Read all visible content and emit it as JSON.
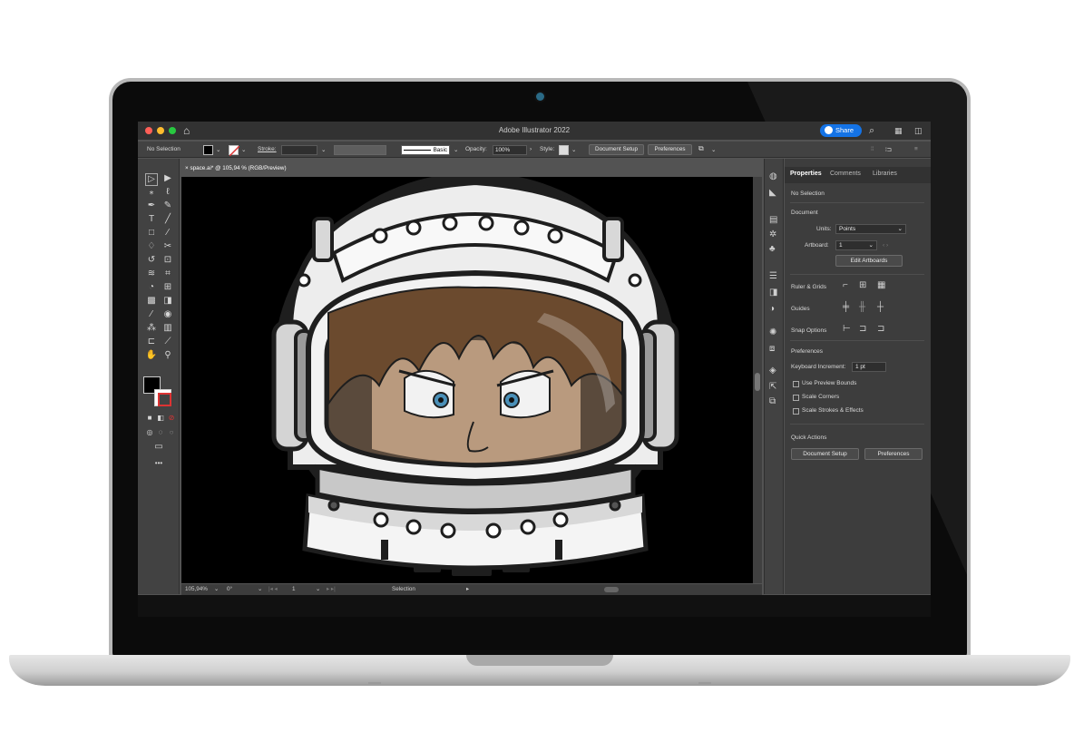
{
  "app": {
    "title": "Adobe Illustrator 2022",
    "share_label": "Share"
  },
  "control_bar": {
    "selection": "No Selection",
    "stroke_label": "Stroke:",
    "brush_label": "Basic",
    "opacity_label": "Opacity:",
    "opacity_value": "100%",
    "style_label": "Style:",
    "document_setup": "Document Setup",
    "preferences": "Preferences"
  },
  "document": {
    "tab_label": "space.ai* @ 105,94 % (RGB/Preview)"
  },
  "status_bar": {
    "zoom": "105,94%",
    "rotation": "0°",
    "artboard": "1",
    "tool": "Selection"
  },
  "panel": {
    "tabs": [
      "Properties",
      "Comments",
      "Libraries"
    ],
    "selection": "No Selection",
    "document_header": "Document",
    "units_label": "Units:",
    "units_value": "Points",
    "artboard_label": "Artboard:",
    "artboard_value": "1",
    "edit_artboards": "Edit Artboards",
    "ruler_grids": "Ruler & Grids",
    "guides": "Guides",
    "snap_options": "Snap Options",
    "preferences_header": "Preferences",
    "keyboard_increment_label": "Keyboard Increment:",
    "keyboard_increment_value": "1 pt",
    "use_preview_bounds": "Use Preview Bounds",
    "scale_corners": "Scale Corners",
    "scale_strokes": "Scale Strokes & Effects",
    "quick_actions": "Quick Actions",
    "document_setup": "Document Setup",
    "preferences": "Preferences"
  },
  "colors": {
    "accent": "#1473e6",
    "close": "#ff5f57",
    "minimize": "#febc2e",
    "zoom": "#28c840"
  }
}
